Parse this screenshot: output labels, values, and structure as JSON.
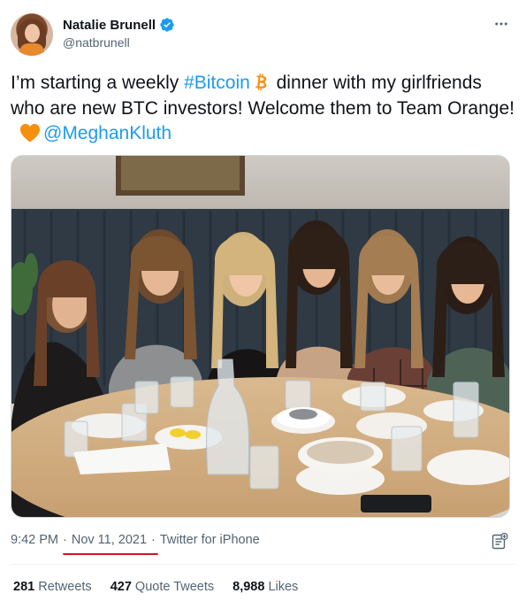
{
  "author": {
    "display_name": "Natalie Brunell",
    "handle": "@natbrunell",
    "verified": true
  },
  "tweet": {
    "text_part1": "I’m starting a weekly ",
    "hashtag": "#Bitcoin",
    "text_part2": " dinner with my girlfriends who are new BTC investors! Welcome them to Team Orange! ",
    "mention": "@MeghanKluth",
    "emoji_btc": "bitcoin-emoji",
    "emoji_heart": "orange-heart-emoji"
  },
  "meta": {
    "time": "9:42 PM",
    "date": "Nov 11, 2021",
    "source": "Twitter for iPhone",
    "separator": "·"
  },
  "stats": [
    {
      "count": "281",
      "label": "Retweets"
    },
    {
      "count": "427",
      "label": "Quote Tweets"
    },
    {
      "count": "8,988",
      "label": "Likes"
    }
  ],
  "colors": {
    "link": "#1d9bf0",
    "secondary_text": "#536471",
    "primary_text": "#0f1419",
    "annotation_underline": "#d1131f",
    "bitcoin_orange": "#f7931a",
    "heart_orange": "#f4900c"
  },
  "icons": {
    "verified": "verified-badge-icon",
    "more": "more-options-icon",
    "analytics": "tweet-analytics-icon"
  }
}
